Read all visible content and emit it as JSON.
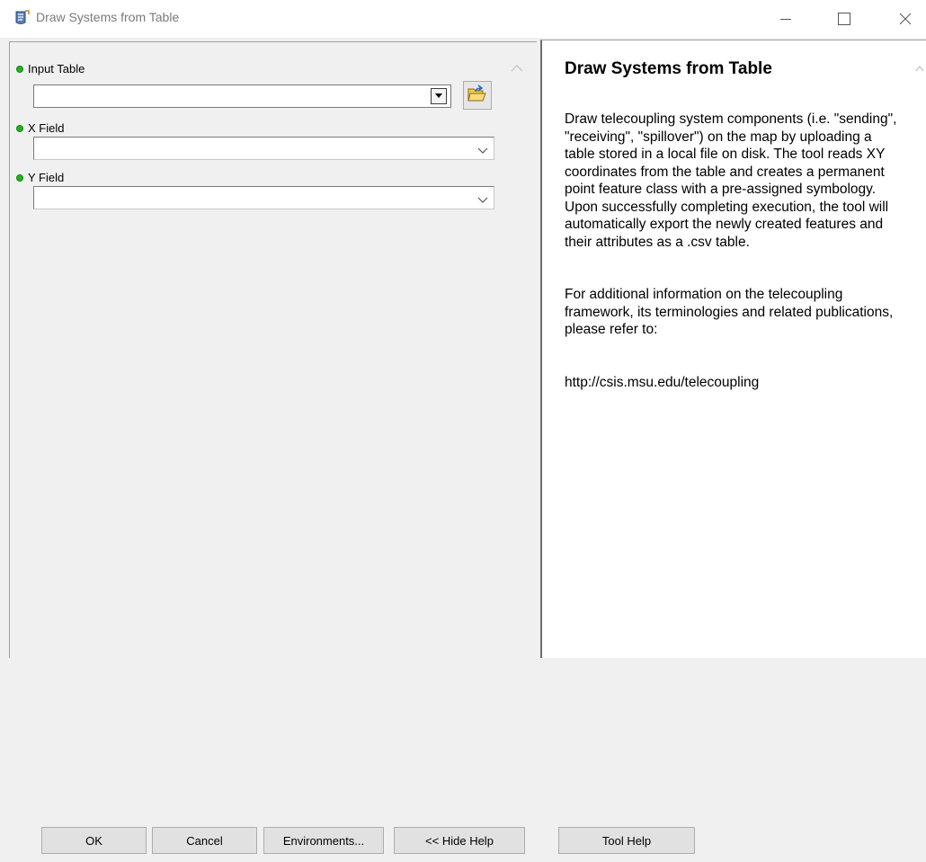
{
  "window": {
    "title": "Draw Systems from Table",
    "icon": "script-tool-icon"
  },
  "parameters": [
    {
      "label": "Input Table",
      "value": "",
      "required": true
    },
    {
      "label": "X Field",
      "value": "",
      "required": true
    },
    {
      "label": "Y Field",
      "value": "",
      "required": true
    }
  ],
  "help": {
    "title": "Draw Systems from Table",
    "paragraphs": [
      "Draw telecoupling system components (i.e. \"sending\", \"receiving\", \"spillover\") on the map by uploading a table stored in a local file on disk. The tool reads XY coordinates from the table and creates a permanent point feature class with a pre-assigned symbology. Upon successfully completing execution, the tool will automatically export the newly created features and their attributes as a .csv table.",
      "For additional information on the telecoupling framework, its terminologies and related publications, please refer to:",
      "http://csis.msu.edu/telecoupling"
    ]
  },
  "buttons": {
    "ok": "OK",
    "cancel": "Cancel",
    "environments": "Environments...",
    "hide_help": "<< Hide Help",
    "tool_help": "Tool Help"
  },
  "colors": {
    "required_dot": "#22b222",
    "title_text": "#7a7a7a"
  }
}
